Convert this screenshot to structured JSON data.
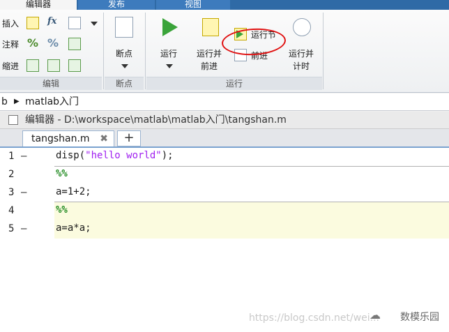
{
  "tabs": [
    {
      "label": "编辑器"
    },
    {
      "label": "发布"
    },
    {
      "label": "视图"
    }
  ],
  "ribbon": {
    "edit_group": {
      "insert_label": "插入",
      "comment_label": "注释",
      "indent_label": "缩进",
      "fx_label": "fx",
      "title": "编辑"
    },
    "breakpoint_group": {
      "label": "断点",
      "title": "断点"
    },
    "run_group": {
      "run_label": "运行",
      "run_advance_label_1": "运行并",
      "run_advance_label_2": "前进",
      "run_section_label": "运行节",
      "advance_label": "前进",
      "run_time_label_1": "运行并",
      "run_time_label_2": "计时",
      "title": "运行"
    }
  },
  "breadcrumb": {
    "prefix": "b",
    "path": "matlab入门"
  },
  "editor": {
    "title": "编辑器 - D:\\workspace\\matlab\\matlab入门\\tangshan.m",
    "file_tab": "tangshan.m",
    "close_glyph": "✖",
    "add_glyph": "+"
  },
  "code": [
    {
      "num": "1",
      "marker": "—",
      "pre": "disp(",
      "str": "\"hello world\"",
      "post": ");"
    },
    {
      "num": "2",
      "marker": "",
      "section": "%%"
    },
    {
      "num": "3",
      "marker": "—",
      "text": "a=1+2;"
    },
    {
      "num": "4",
      "marker": "",
      "section": "%%"
    },
    {
      "num": "5",
      "marker": "—",
      "text": "a=a*a;"
    }
  ],
  "watermark": {
    "url": "https://blog.csdn.net/wei...",
    "brand": "数模乐园"
  },
  "colors": {
    "accent": "#2f6aa6",
    "string": "#a020f0",
    "section": "#228b22",
    "highlight": "#fbfbdf",
    "annotation": "#e01010"
  }
}
